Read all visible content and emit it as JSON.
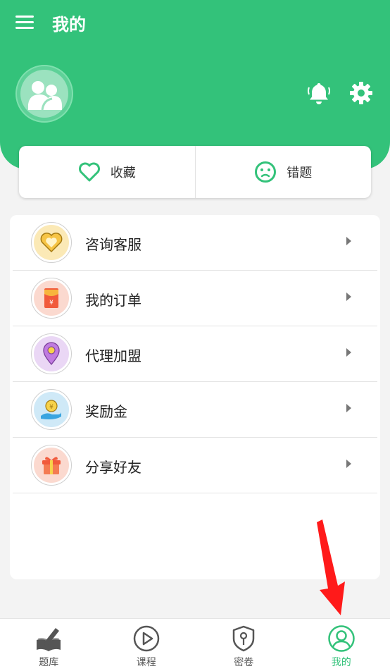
{
  "header": {
    "title": "我的"
  },
  "colors": {
    "brand": "#33c27a",
    "arrow": "#ff1a1a"
  },
  "quick_actions": [
    {
      "label": "收藏",
      "icon": "heart-outline-icon"
    },
    {
      "label": "错题",
      "icon": "sad-face-icon"
    }
  ],
  "menu": [
    {
      "label": "咨询客服",
      "icon": "heart-badge-icon"
    },
    {
      "label": "我的订单",
      "icon": "red-envelope-icon"
    },
    {
      "label": "代理加盟",
      "icon": "location-pin-icon"
    },
    {
      "label": "奖励金",
      "icon": "coin-hand-icon"
    },
    {
      "label": "分享好友",
      "icon": "gift-box-icon"
    }
  ],
  "tabbar": [
    {
      "label": "题库",
      "icon": "book-pen-icon",
      "active": false
    },
    {
      "label": "课程",
      "icon": "play-circle-icon",
      "active": false
    },
    {
      "label": "密卷",
      "icon": "shield-key-icon",
      "active": false
    },
    {
      "label": "我的",
      "icon": "user-circle-icon",
      "active": true
    }
  ]
}
